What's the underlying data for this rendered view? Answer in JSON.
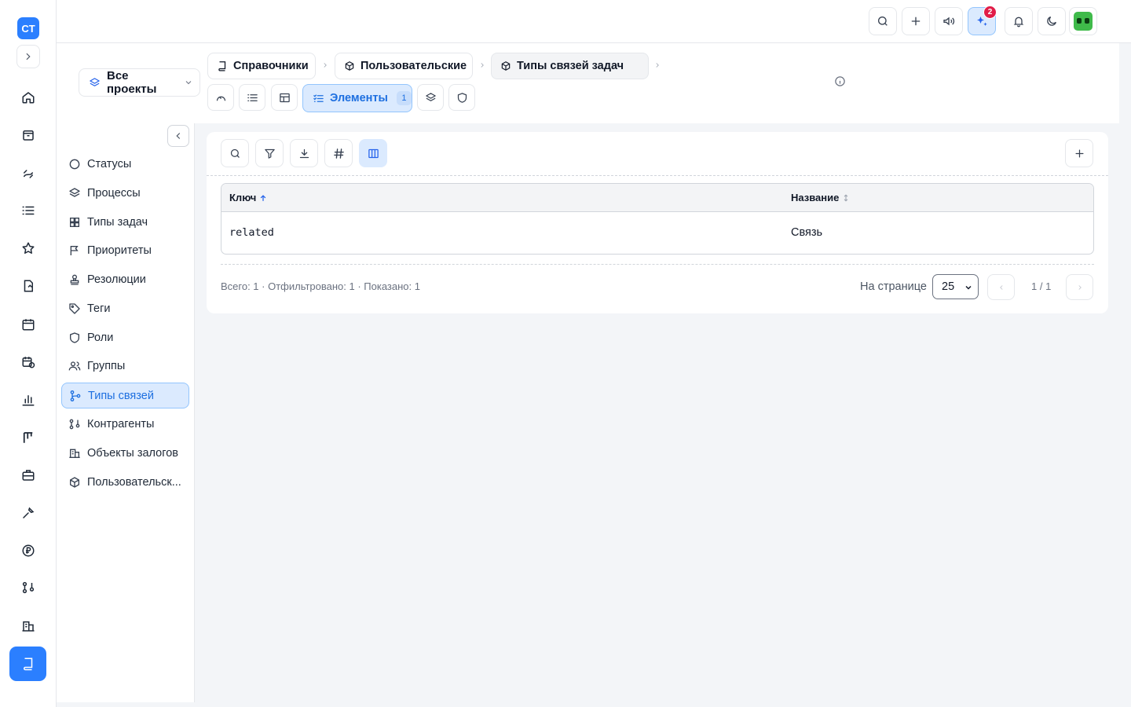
{
  "rail": {
    "logo": "CT",
    "items": [
      "home-icon",
      "archive-icon",
      "route-icon",
      "list-icon",
      "star-icon",
      "document-icon",
      "calendar-icon",
      "calendar-clock-icon",
      "chart-icon",
      "kanban-icon",
      "briefcase-icon",
      "wrench-icon",
      "ruble-icon",
      "network-icon",
      "building-icon",
      "book-icon"
    ]
  },
  "topbar": {
    "notif_badge": "2"
  },
  "header": {
    "project_select": "Все проекты",
    "breadcrumbs": [
      "Справочники",
      "Пользовательские",
      "Типы связей задач"
    ],
    "active_tab": {
      "label": "Элементы",
      "count": "1"
    }
  },
  "sidebar": {
    "items": [
      {
        "label": "Статусы",
        "icon": "circle-icon"
      },
      {
        "label": "Процессы",
        "icon": "layers-icon"
      },
      {
        "label": "Типы задач",
        "icon": "grid-icon"
      },
      {
        "label": "Приоритеты",
        "icon": "flag-icon"
      },
      {
        "label": "Резолюции",
        "icon": "stamp-icon"
      },
      {
        "label": "Теги",
        "icon": "tag-icon"
      },
      {
        "label": "Роли",
        "icon": "shield-icon"
      },
      {
        "label": "Группы",
        "icon": "users-icon"
      },
      {
        "label": "Типы связей",
        "icon": "git-branch-icon",
        "active": true
      },
      {
        "label": "Контрагенты",
        "icon": "network-icon"
      },
      {
        "label": "Объекты залогов",
        "icon": "building-icon"
      },
      {
        "label": "Пользовательск...",
        "icon": "box-icon"
      }
    ]
  },
  "table": {
    "columns": [
      {
        "label": "Ключ",
        "sort": "asc"
      },
      {
        "label": "Название",
        "sort": "none"
      }
    ],
    "rows": [
      {
        "key": "related",
        "name": "Связь"
      }
    ]
  },
  "footer": {
    "stats": "Всего: 1 · Отфильтровано: 1 · Показано: 1",
    "per_page_label": "На странице",
    "per_page_value": "25",
    "page_info": "1 / 1"
  },
  "colors": {
    "accent": "#2b7fff",
    "active_bg": "#dbeafe",
    "badge": "#e11d48"
  }
}
